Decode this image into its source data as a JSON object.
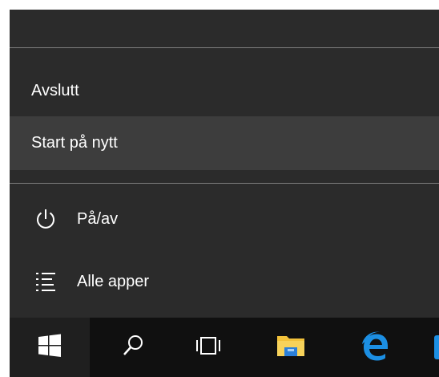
{
  "power_menu": {
    "items": [
      {
        "label": "Avslutt"
      },
      {
        "label": "Start på nytt"
      }
    ]
  },
  "start_menu": {
    "power_label": "På/av",
    "all_apps_label": "Alle apper"
  },
  "taskbar": {
    "buttons": [
      "windows-logo-icon",
      "search-icon",
      "task-view-icon",
      "file-explorer-icon",
      "edge-icon"
    ]
  },
  "colors": {
    "menu_bg": "#2b2b2b",
    "highlight": "#3d3d3d",
    "taskbar_bg": "#101010",
    "text": "#ffffff"
  }
}
